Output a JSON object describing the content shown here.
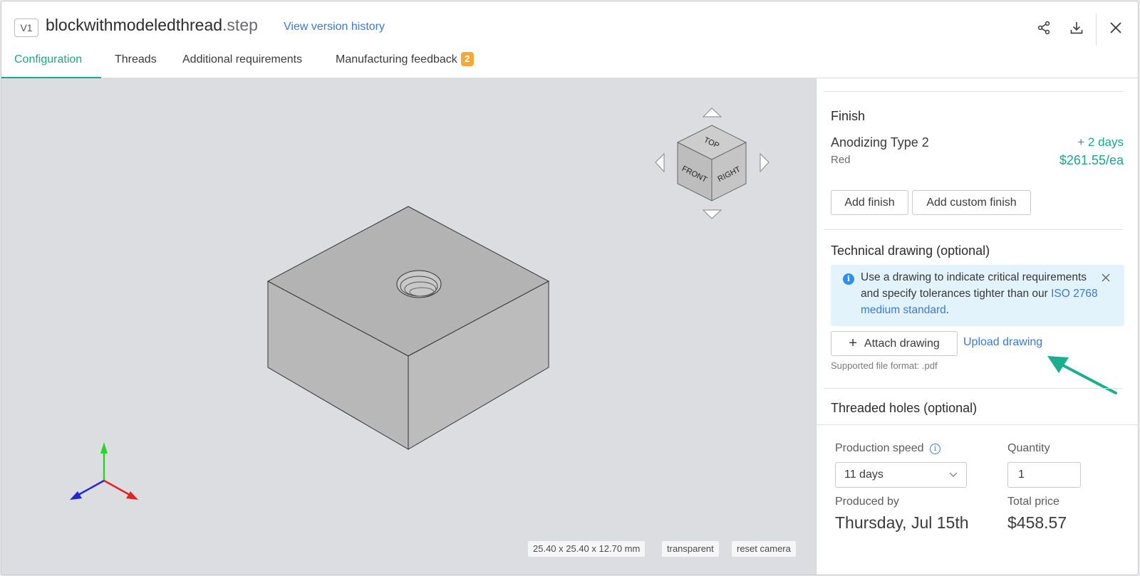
{
  "header": {
    "version": "V1",
    "file_base": "blockwithmodeledthread",
    "file_ext": ".step",
    "version_history_label": "View version history",
    "share_icon": "share-icon",
    "download_icon": "download-icon",
    "close_icon": "close-icon"
  },
  "tabs": [
    {
      "label": "Configuration",
      "active": true
    },
    {
      "label": "Threads"
    },
    {
      "label": "Additional requirements"
    },
    {
      "label": "Manufacturing feedback",
      "badge": "2"
    }
  ],
  "viewer": {
    "view_cube": {
      "top": "TOP",
      "front": "FRONT",
      "right": "RIGHT"
    },
    "dimensions_label": "25.40 x 25.40 x 12.70 mm",
    "transparent_label": "transparent",
    "reset_camera_label": "reset camera"
  },
  "finish": {
    "title": "Finish",
    "name": "Anodizing Type 2",
    "color": "Red",
    "lead_time": "+ 2 days",
    "price": "$261.55/ea",
    "add_finish_label": "Add finish",
    "add_custom_finish_label": "Add custom finish"
  },
  "technical_drawing": {
    "title": "Technical drawing (optional)",
    "info_text": "Use a drawing to indicate critical requirements and specify tolerances tighter than our ",
    "info_link": "ISO 2768 medium standard",
    "info_end": ".",
    "attach_label": "Attach drawing",
    "upload_label": "Upload drawing",
    "supported_format": "Supported file format: .pdf"
  },
  "threaded_holes": {
    "title": "Threaded holes (optional)"
  },
  "order": {
    "production_speed_label": "Production speed",
    "production_speed_value": "11 days",
    "quantity_label": "Quantity",
    "quantity_value": "1",
    "produced_by_label": "Produced by",
    "produced_by_value": "Thursday, Jul 15th",
    "total_price_label": "Total price",
    "total_price_value": "$458.57"
  },
  "colors": {
    "accent": "#18a88a",
    "link": "#3b78d6",
    "badge": "#f4a935",
    "info_bg": "#e3f3fb"
  }
}
